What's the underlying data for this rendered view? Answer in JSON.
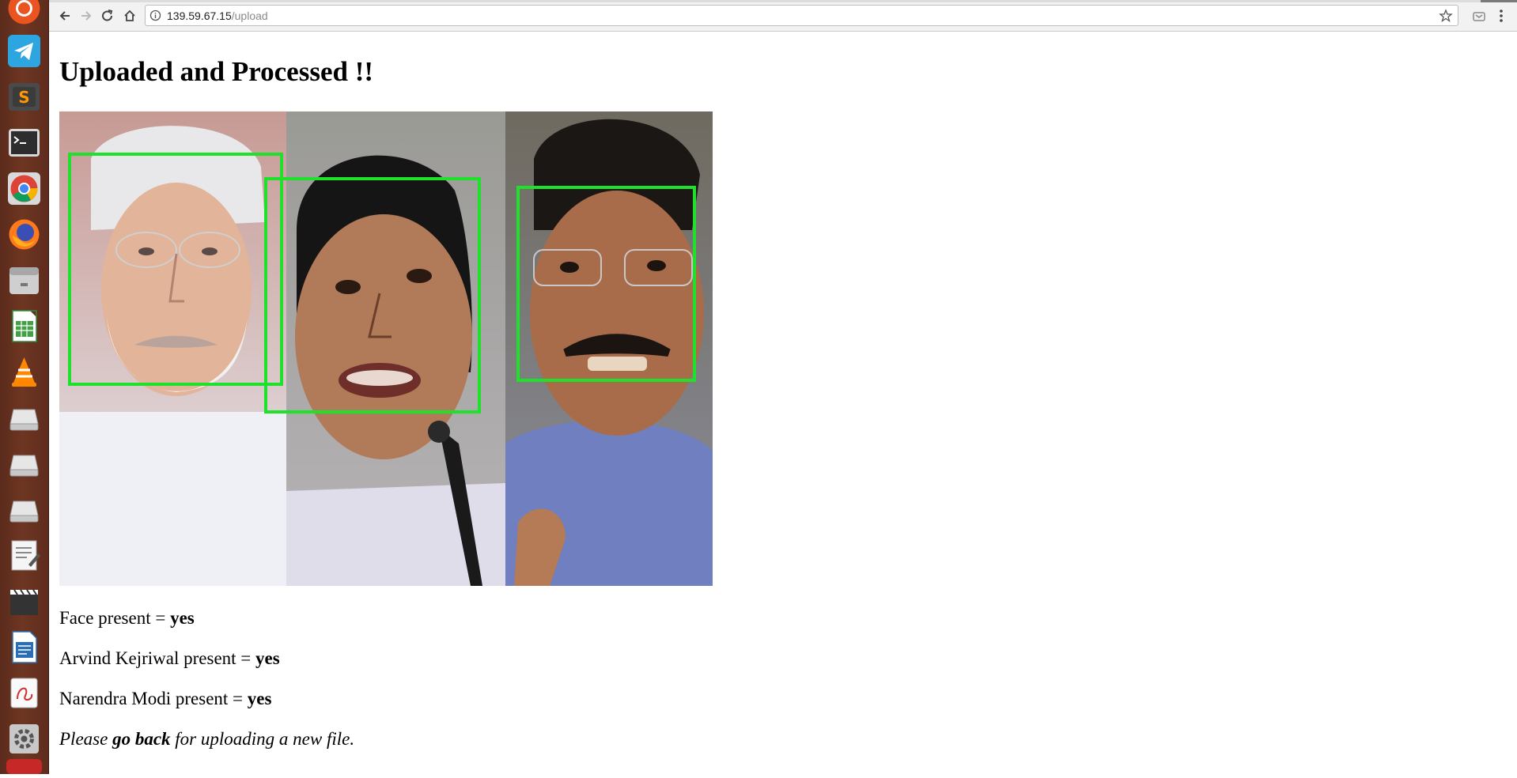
{
  "browser": {
    "url_host": "139.59.67.15",
    "url_path": "/upload"
  },
  "launcher": {
    "items": [
      "ubuntu-dash-icon",
      "telegram-icon",
      "sublime-text-icon",
      "terminal-icon",
      "chrome-icon",
      "firefox-icon",
      "files-icon",
      "libreoffice-calc-icon",
      "vlc-icon",
      "drive-icon",
      "drive-icon",
      "drive-icon",
      "text-editor-icon",
      "video-editor-icon",
      "libreoffice-writer-icon",
      "document-viewer-icon",
      "system-settings-icon"
    ]
  },
  "page": {
    "title": "Uploaded and Processed !!",
    "results": [
      {
        "label": "Face present = ",
        "value": "yes"
      },
      {
        "label": "Arvind Kejriwal present = ",
        "value": "yes"
      },
      {
        "label": "Narendra Modi present = ",
        "value": "yes"
      }
    ],
    "note": {
      "before": "Please ",
      "link": "go back",
      "after": " for uploading a new file."
    }
  },
  "image": {
    "box_color": "#1fe02a",
    "panels": [
      "panel-left-white-haired-man",
      "panel-middle-woman",
      "panel-right-man-with-moustache"
    ]
  }
}
